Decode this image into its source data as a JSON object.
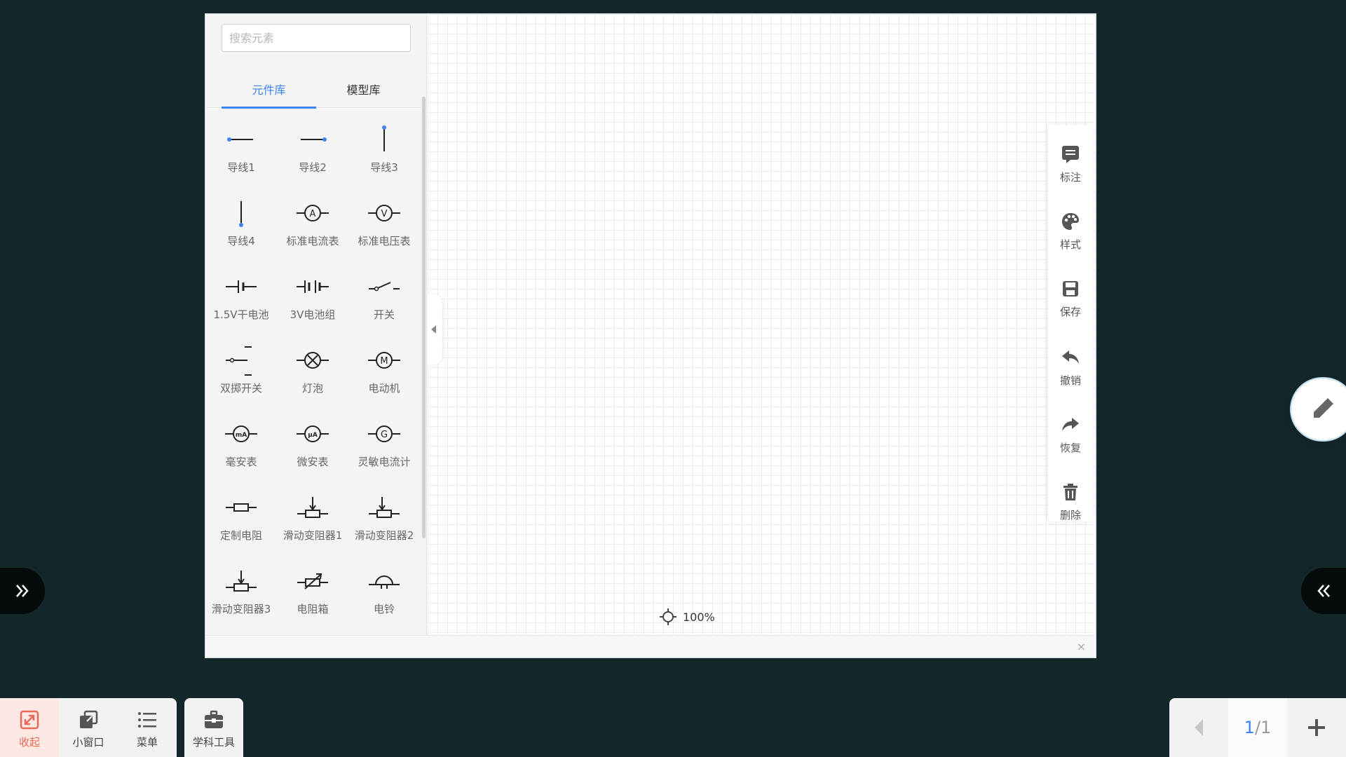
{
  "search": {
    "placeholder": "搜索元素"
  },
  "tabs": [
    {
      "label": "元件库",
      "active": true
    },
    {
      "label": "模型库",
      "active": false
    }
  ],
  "components": [
    {
      "label": "导线1",
      "icon": "wire-left-dot-icon"
    },
    {
      "label": "导线2",
      "icon": "wire-right-dot-icon"
    },
    {
      "label": "导线3",
      "icon": "wire-vertical-top-dot-icon"
    },
    {
      "label": "导线4",
      "icon": "wire-vertical-bottom-dot-icon"
    },
    {
      "label": "标准电流表",
      "icon": "ammeter-icon",
      "symbol": "A"
    },
    {
      "label": "标准电压表",
      "icon": "voltmeter-icon",
      "symbol": "V"
    },
    {
      "label": "1.5V干电池",
      "icon": "battery-icon"
    },
    {
      "label": "3V电池组",
      "icon": "battery-pack-icon"
    },
    {
      "label": "开关",
      "icon": "switch-icon"
    },
    {
      "label": "双掷开关",
      "icon": "double-throw-switch-icon"
    },
    {
      "label": "灯泡",
      "icon": "lamp-icon"
    },
    {
      "label": "电动机",
      "icon": "motor-icon",
      "symbol": "M"
    },
    {
      "label": "毫安表",
      "icon": "milliammeter-icon",
      "symbol": "mA"
    },
    {
      "label": "微安表",
      "icon": "microammeter-icon",
      "symbol": "μA"
    },
    {
      "label": "灵敏电流计",
      "icon": "galvanometer-icon",
      "symbol": "G"
    },
    {
      "label": "定制电阻",
      "icon": "resistor-icon"
    },
    {
      "label": "滑动变阻器1",
      "icon": "rheostat-1-icon"
    },
    {
      "label": "滑动变阻器2",
      "icon": "rheostat-2-icon"
    },
    {
      "label": "滑动变阻器3",
      "icon": "rheostat-3-icon"
    },
    {
      "label": "电阻箱",
      "icon": "resistance-box-icon"
    },
    {
      "label": "电铃",
      "icon": "bell-icon"
    }
  ],
  "canvas": {
    "zoom": "100%"
  },
  "right_toolbar": [
    {
      "label": "标注",
      "icon": "annotation-icon"
    },
    {
      "label": "样式",
      "icon": "palette-icon"
    },
    {
      "label": "保存",
      "icon": "save-icon"
    },
    {
      "label": "撤销",
      "icon": "undo-icon"
    },
    {
      "label": "恢复",
      "icon": "redo-icon"
    },
    {
      "label": "删除",
      "icon": "trash-icon"
    }
  ],
  "dock": [
    {
      "label": "收起",
      "icon": "collapse-icon"
    },
    {
      "label": "小窗口",
      "icon": "small-window-icon"
    },
    {
      "label": "菜单",
      "icon": "menu-icon"
    }
  ],
  "tools": {
    "label": "学科工具",
    "icon": "toolbox-icon"
  },
  "pager": {
    "current": "1",
    "total": "/1"
  },
  "colors": {
    "accent": "#3d84f5",
    "background": "#13262a",
    "collapse_active": "#e8695a"
  }
}
